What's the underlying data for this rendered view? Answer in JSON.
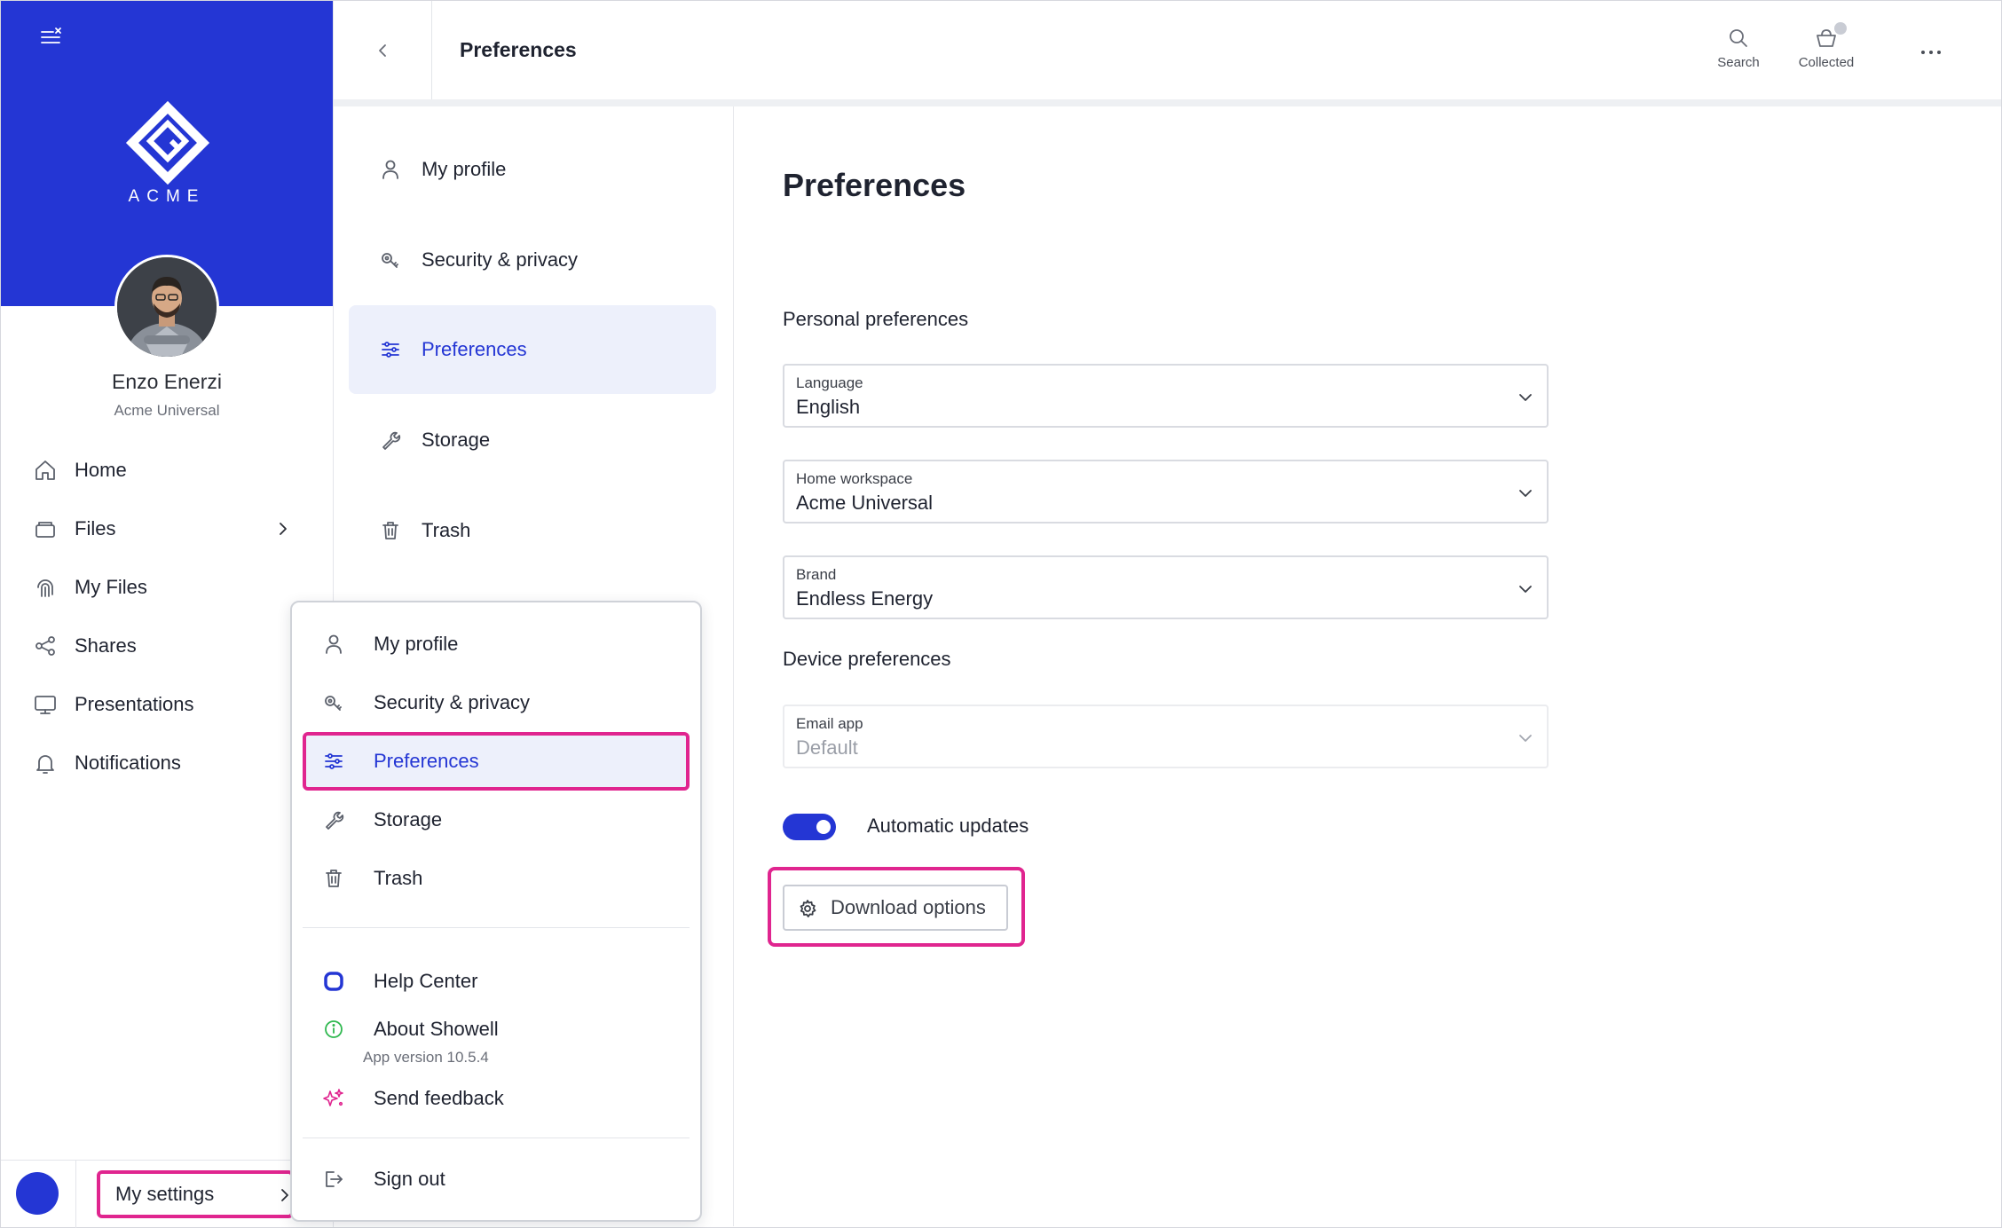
{
  "brand": {
    "wordmark": "ACME",
    "color": "#2436d4",
    "highlight_color": "#e0258f"
  },
  "user": {
    "name": "Enzo Enerzi",
    "organization": "Acme Universal"
  },
  "sidebar": {
    "items": [
      {
        "label": "Home",
        "icon": "home-icon"
      },
      {
        "label": "Files",
        "icon": "folder-icon",
        "has_submenu": true
      },
      {
        "label": "My Files",
        "icon": "fingerprint-icon"
      },
      {
        "label": "Shares",
        "icon": "share-icon"
      },
      {
        "label": "Presentations",
        "icon": "monitor-icon"
      },
      {
        "label": "Notifications",
        "icon": "bell-icon"
      }
    ],
    "settings_label": "My settings"
  },
  "header": {
    "title": "Preferences",
    "search_label": "Search",
    "collected_label": "Collected"
  },
  "settings_menu": {
    "items": [
      {
        "label": "My profile",
        "icon": "person-icon"
      },
      {
        "label": "Security & privacy",
        "icon": "security-icon"
      },
      {
        "label": "Preferences",
        "icon": "sliders-icon",
        "active": true
      },
      {
        "label": "Storage",
        "icon": "wrench-icon"
      },
      {
        "label": "Trash",
        "icon": "trash-icon"
      }
    ]
  },
  "main": {
    "title": "Preferences",
    "personal_section": "Personal preferences",
    "language": {
      "label": "Language",
      "value": "English"
    },
    "home_workspace": {
      "label": "Home workspace",
      "value": "Acme Universal"
    },
    "brand_select": {
      "label": "Brand",
      "value": "Endless Energy"
    },
    "device_section": "Device preferences",
    "email_app": {
      "label": "Email app",
      "value": "Default",
      "disabled": true
    },
    "automatic_updates": {
      "label": "Automatic updates",
      "enabled": true
    },
    "download_options_label": "Download options"
  },
  "popup_menu": {
    "items": [
      {
        "label": "My profile"
      },
      {
        "label": "Security & privacy"
      },
      {
        "label": "Preferences",
        "active": true
      },
      {
        "label": "Storage"
      },
      {
        "label": "Trash"
      }
    ],
    "help_center": "Help Center",
    "about": "About Showell",
    "app_version": "App version 10.5.4",
    "send_feedback": "Send feedback",
    "sign_out": "Sign out"
  }
}
